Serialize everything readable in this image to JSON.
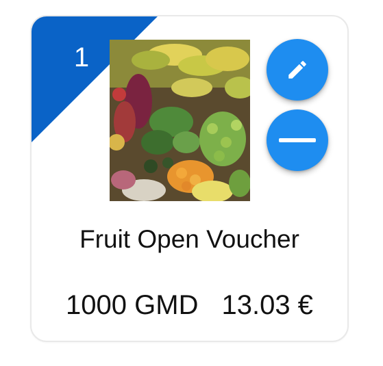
{
  "voucher": {
    "index": "1",
    "title": "Fruit Open Voucher",
    "price_gmd": "1000 GMD",
    "price_eur": "13.03 €",
    "image": "fruit-market-stall-photo"
  },
  "actions": {
    "edit_icon": "pencil-icon",
    "remove_icon": "minus-icon"
  },
  "colors": {
    "ribbon": "#0a63c7",
    "fab": "#1e8df0",
    "text": "#111111",
    "card_border": "#e9e9e9"
  }
}
